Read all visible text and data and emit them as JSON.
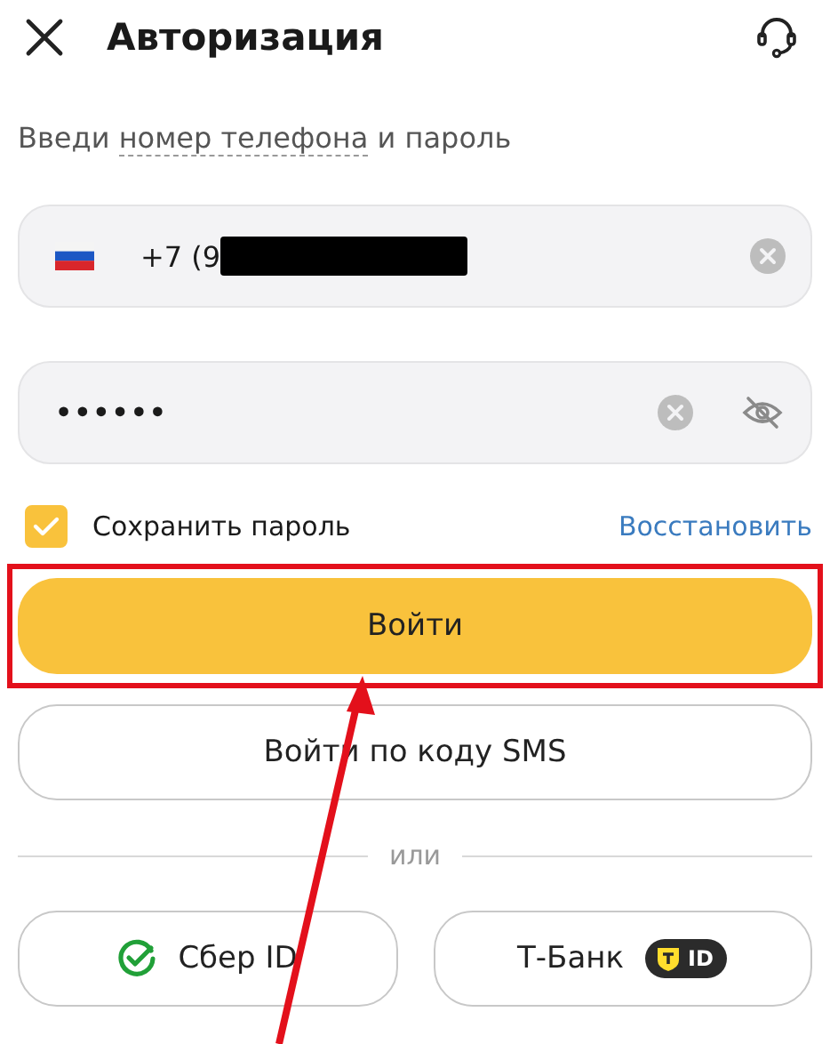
{
  "header": {
    "title": "Авторизация"
  },
  "subtitle": {
    "before": "Введи",
    "link": "номер телефона",
    "after": "и пароль"
  },
  "phone_field": {
    "value": "+7 (9",
    "redacted": true
  },
  "password_field": {
    "value": "••••••",
    "visible": false
  },
  "save_password": {
    "label": "Сохранить пароль",
    "checked": true
  },
  "restore_link": "Восстановить",
  "login_button": {
    "label": "Войти",
    "highlighted": true
  },
  "sms_button": "Войти по коду SMS",
  "divider": "или",
  "alt_logins": [
    {
      "kind": "sber",
      "label": "Сбер ID"
    },
    {
      "kind": "tbank",
      "label": "Т-Банк",
      "badge": "ID"
    }
  ]
}
